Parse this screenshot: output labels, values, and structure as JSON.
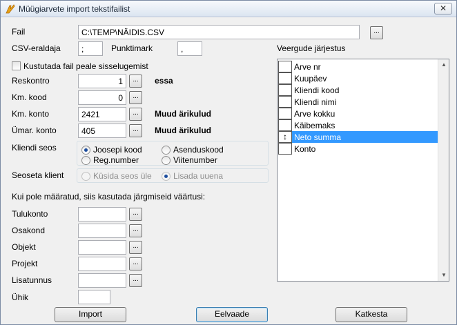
{
  "window": {
    "title": "Müügiarvete import tekstifailist",
    "close_symbol": "✕"
  },
  "fields": {
    "fail": {
      "label": "Fail",
      "value": "C:\\TEMP\\NÄIDIS.CSV"
    },
    "csv": {
      "label": "CSV-eraldaja",
      "value": ";"
    },
    "punktimark": {
      "label": "Punktimark",
      "value": ","
    },
    "kustutada": {
      "label": "Kustutada fail peale sisselugemist",
      "checked": false
    },
    "reskontro": {
      "label": "Reskontro",
      "value": "1",
      "info": "essa"
    },
    "km_kood": {
      "label": "Km. kood",
      "value": "0"
    },
    "km_konto": {
      "label": "Km. konto",
      "value": "2421",
      "info": "Muud ärikulud"
    },
    "umar_konto": {
      "label": "Ümar. konto",
      "value": "405",
      "info": "Muud ärikulud"
    },
    "browse_label": "..."
  },
  "kliendi_seos": {
    "label": "Kliendi seos",
    "options": [
      "Joosepi kood",
      "Asenduskood",
      "Reg.number",
      "Viitenumber"
    ],
    "selected": "Joosepi kood"
  },
  "seoseta_klient": {
    "label": "Seoseta klient",
    "options": [
      "Küsida seos üle",
      "Lisada uuena"
    ],
    "selected": "Lisada uuena",
    "enabled": false
  },
  "defaults": {
    "heading": "Kui pole määratud, siis kasutada järgmiseid väärtusi:",
    "tulukonto": {
      "label": "Tulukonto",
      "value": ""
    },
    "osakond": {
      "label": "Osakond",
      "value": ""
    },
    "objekt": {
      "label": "Objekt",
      "value": ""
    },
    "projekt": {
      "label": "Projekt",
      "value": ""
    },
    "lisatunnus": {
      "label": "Lisatunnus",
      "value": ""
    },
    "uhik": {
      "label": "Ühik",
      "value": ""
    }
  },
  "columns": {
    "label": "Veergude järjestus",
    "items": [
      "Arve nr",
      "Kuupäev",
      "Kliendi kood",
      "Kliendi nimi",
      "Arve kokku",
      "Käibemaks",
      "Neto summa",
      "Konto"
    ],
    "selected": "Neto summa",
    "selected_marker": "↕",
    "scroll_up": "▲",
    "scroll_down": "▼"
  },
  "buttons": {
    "import": "Import",
    "eelvaade": "Eelvaade",
    "katkesta": "Katkesta"
  }
}
